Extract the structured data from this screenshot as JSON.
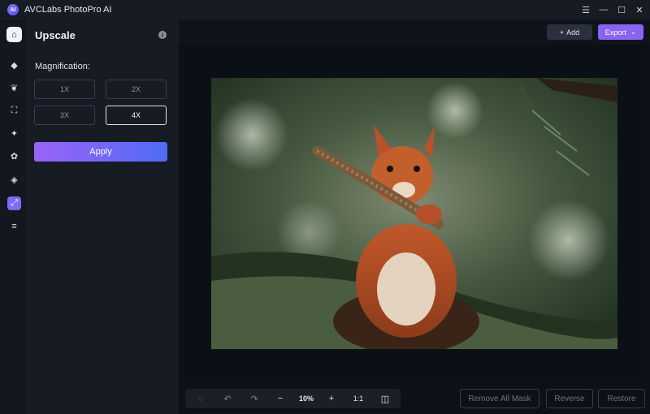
{
  "window": {
    "title": "AVCLabs PhotoPro AI",
    "logo_text": "AI",
    "controls": {
      "menu": "☰",
      "minimize": "—",
      "maximize": "☐",
      "close": "✕"
    }
  },
  "rail": {
    "items": [
      {
        "name": "home-icon",
        "glyph": "⌂",
        "active": false
      },
      {
        "name": "eraser-icon",
        "glyph": "◆",
        "active": false
      },
      {
        "name": "face-icon",
        "glyph": "❦",
        "active": false
      },
      {
        "name": "crop-icon",
        "glyph": "⛶",
        "active": false
      },
      {
        "name": "magic-icon",
        "glyph": "✦",
        "active": false
      },
      {
        "name": "blur-icon",
        "glyph": "✿",
        "active": false
      },
      {
        "name": "colorize-icon",
        "glyph": "◈",
        "active": false
      },
      {
        "name": "upscale-icon",
        "glyph": "⤢",
        "active": true
      },
      {
        "name": "adjust-icon",
        "glyph": "≡",
        "active": false
      }
    ]
  },
  "panel": {
    "title": "Upscale",
    "info_glyph": "i",
    "magnification_label": "Magnification:",
    "options": [
      "1X",
      "2X",
      "3X",
      "4X"
    ],
    "selected": "4X",
    "apply_label": "Apply"
  },
  "header": {
    "add_icon": "+",
    "add_label": "Add",
    "export_label": "Export",
    "export_arrow": "⌄"
  },
  "toolbar": {
    "select_icon": "◌",
    "undo_icon": "↶",
    "redo_icon": "↷",
    "zoom_out": "−",
    "zoom_level": "10%",
    "zoom_in": "+",
    "ratio": "1:1",
    "compare_icon": "◫"
  },
  "actions": {
    "remove_all_mask": "Remove All Mask",
    "reverse": "Reverse",
    "restore": "Restore"
  }
}
